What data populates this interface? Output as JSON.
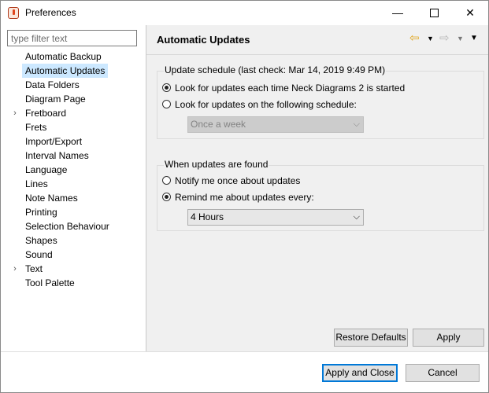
{
  "window": {
    "title": "Preferences",
    "minimize_glyph": "—",
    "close_glyph": "✕"
  },
  "filter": {
    "placeholder": "type filter text"
  },
  "tree": {
    "items": [
      {
        "label": "Automatic Backup",
        "expandable": false,
        "selected": false
      },
      {
        "label": "Automatic Updates",
        "expandable": false,
        "selected": true
      },
      {
        "label": "Data Folders",
        "expandable": false,
        "selected": false
      },
      {
        "label": "Diagram Page",
        "expandable": false,
        "selected": false
      },
      {
        "label": "Fretboard",
        "expandable": true,
        "selected": false
      },
      {
        "label": "Frets",
        "expandable": false,
        "selected": false
      },
      {
        "label": "Import/Export",
        "expandable": false,
        "selected": false
      },
      {
        "label": "Interval Names",
        "expandable": false,
        "selected": false
      },
      {
        "label": "Language",
        "expandable": false,
        "selected": false
      },
      {
        "label": "Lines",
        "expandable": false,
        "selected": false
      },
      {
        "label": "Note Names",
        "expandable": false,
        "selected": false
      },
      {
        "label": "Printing",
        "expandable": false,
        "selected": false
      },
      {
        "label": "Selection Behaviour",
        "expandable": false,
        "selected": false
      },
      {
        "label": "Shapes",
        "expandable": false,
        "selected": false
      },
      {
        "label": "Sound",
        "expandable": false,
        "selected": false
      },
      {
        "label": "Text",
        "expandable": true,
        "selected": false
      },
      {
        "label": "Tool Palette",
        "expandable": false,
        "selected": false
      }
    ],
    "arrow_glyph": "›"
  },
  "page": {
    "title": "Automatic Updates",
    "nav": {
      "back_glyph": "⇦",
      "dropdown_glyph": "▼",
      "forward_glyph": "⇨",
      "menu_glyph": "▼"
    }
  },
  "schedule_group": {
    "legend": "Update schedule (last check: Mar 14, 2019 9:49 PM)",
    "option_startup": "Look for updates each time Neck Diagrams 2 is started",
    "option_schedule": "Look for updates on the following schedule:",
    "selected": "startup",
    "schedule_value": "Once a week"
  },
  "found_group": {
    "legend": "When updates are found",
    "option_notify": "Notify me once about updates",
    "option_remind": "Remind me about updates every:",
    "selected": "remind",
    "remind_value": "4 Hours"
  },
  "buttons": {
    "restore_defaults": "Restore Defaults",
    "apply": "Apply",
    "apply_and_close": "Apply and Close",
    "cancel": "Cancel"
  },
  "combo_arrow_glyph": "⌵"
}
